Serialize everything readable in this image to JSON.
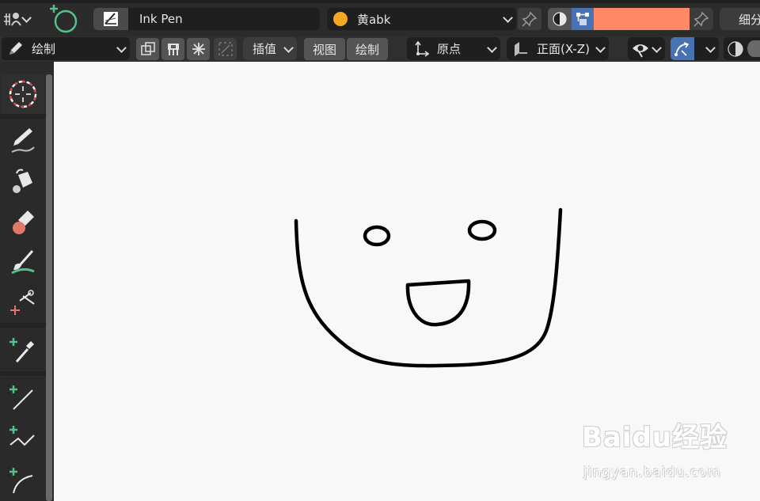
{
  "header": {
    "brush_name": "Ink Pen",
    "material_name": "黄abk",
    "material_color": "#f5a623",
    "stroke_color": "#ff8a65",
    "detail_label": "细分"
  },
  "toolbar": {
    "mode_label": "绘制",
    "interpolate_label": "插值",
    "view_label": "视图",
    "draw_label": "绘制",
    "origin_label": "原点",
    "orientation_label": "正面(X-Z)"
  },
  "tools": [
    {
      "name": "cursor",
      "icon": "cursor-icon"
    },
    {
      "name": "draw",
      "icon": "pencil-icon"
    },
    {
      "name": "fill",
      "icon": "bucket-icon"
    },
    {
      "name": "erase",
      "icon": "eraser-icon"
    },
    {
      "name": "tint",
      "icon": "brush-icon"
    },
    {
      "name": "cutter",
      "icon": "scissors-icon"
    },
    {
      "name": "eyedropper",
      "icon": "eyedropper-icon"
    },
    {
      "name": "line",
      "icon": "line-icon"
    },
    {
      "name": "polyline",
      "icon": "polyline-icon"
    },
    {
      "name": "arc",
      "icon": "arc-icon"
    }
  ],
  "colors": {
    "accent_green": "#56c08a",
    "active_blue": "#4772b3",
    "panel": "#2b2b2b",
    "canvas": "#f8f8f8"
  },
  "watermark": {
    "logo": "Baidu经验",
    "url": "jingyan.baidu.com"
  }
}
